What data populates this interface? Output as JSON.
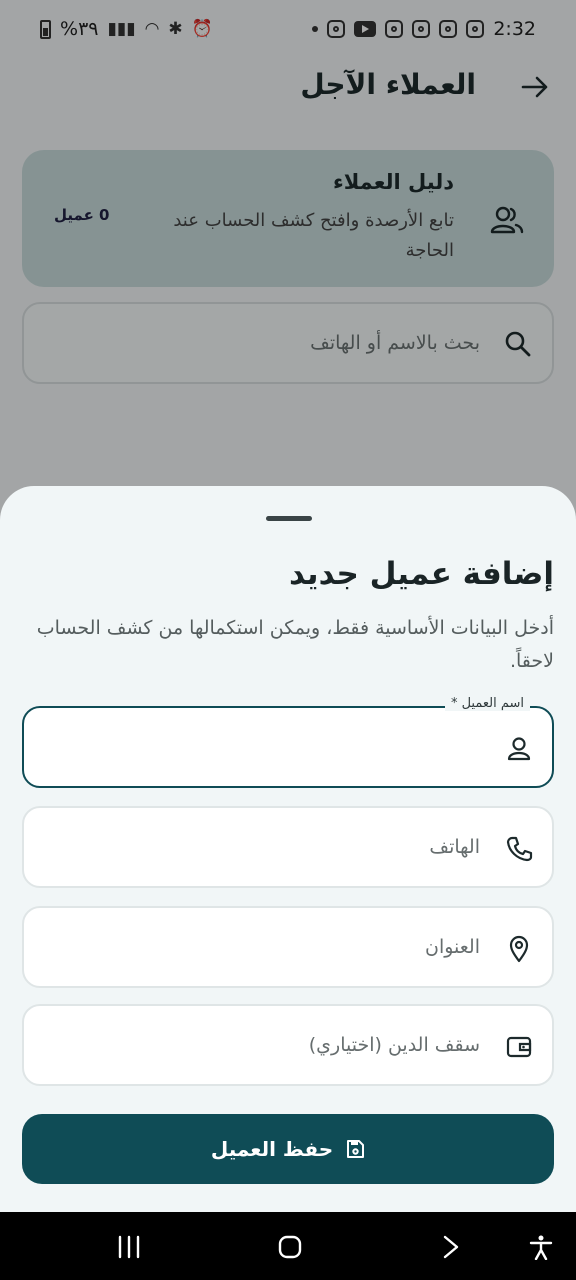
{
  "status_bar": {
    "time": "2:32",
    "battery_text": "%٣٩",
    "icons": [
      "instagram-icon",
      "instagram-icon",
      "instagram-icon",
      "instagram-icon",
      "youtube-icon",
      "instagram-icon",
      "dot-icon"
    ]
  },
  "header": {
    "title": "العملاء الآجل"
  },
  "directory_card": {
    "title": "دليل العملاء",
    "description": "تابع الأرصدة وافتح كشف الحساب عند الحاجة",
    "count": "0 عميل"
  },
  "search": {
    "placeholder": "بحث بالاسم أو الهاتف"
  },
  "sheet": {
    "title": "إضافة عميل جديد",
    "subtitle": "أدخل البيانات الأساسية فقط، ويمكن استكمالها من كشف الحساب لاحقاً.",
    "fields": {
      "name_label": "اسم العميل *",
      "phone_placeholder": "الهاتف",
      "address_placeholder": "العنوان",
      "credit_placeholder": "سقف الدين (اختياري)"
    },
    "save_label": "حفظ العميل"
  },
  "colors": {
    "primary": "#0f4c56",
    "card_bg": "#c8dcdc",
    "sheet_bg": "#f1f6f7"
  }
}
